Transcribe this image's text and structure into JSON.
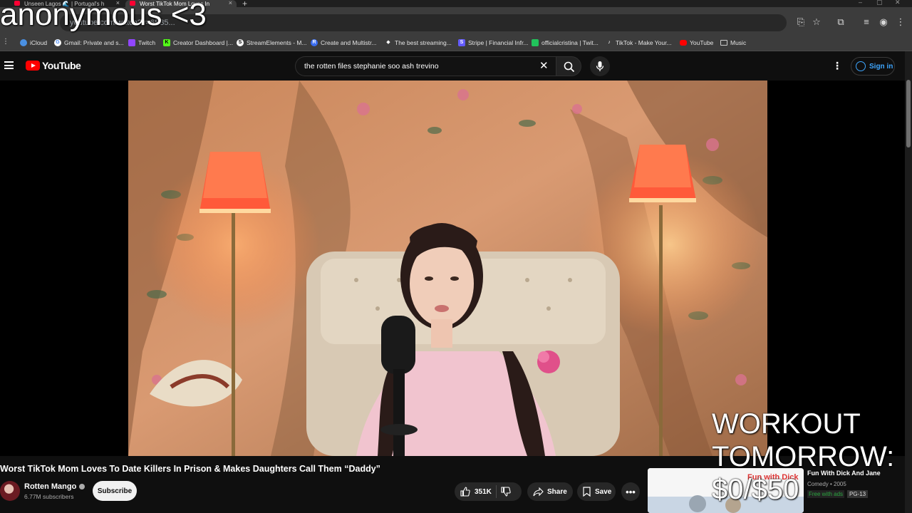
{
  "browser": {
    "tabs": [
      {
        "label": "Unseen Lagos 🌊 | Portugal's h"
      },
      {
        "label": "Worst TikTok Mom Loves In"
      }
    ],
    "url": "youtube.com/watch?v=6S35...",
    "bookmarks": [
      {
        "label": "iCloud",
        "icon": "cloud-icon",
        "color": "#4a90e2"
      },
      {
        "label": "Gmail: Private and s...",
        "icon": "google-icon",
        "color": "#ffffff"
      },
      {
        "label": "Twitch",
        "icon": "twitch-icon",
        "color": "#9146ff"
      },
      {
        "label": "Creator Dashboard |...",
        "icon": "kick-icon",
        "color": "#53fc18"
      },
      {
        "label": "StreamElements - M...",
        "icon": "streamelements-icon",
        "color": "#ffffff"
      },
      {
        "label": "Create and Multistr...",
        "icon": "restream-icon",
        "color": "#3a6df0"
      },
      {
        "label": "The best streaming...",
        "icon": "diamond-icon",
        "color": "#ffffff"
      },
      {
        "label": "Stripe | Financial Infr...",
        "icon": "stripe-icon",
        "color": "#635bff"
      },
      {
        "label": "officialcristina | Twit...",
        "icon": "twitch-green-icon",
        "color": "#21c35b"
      },
      {
        "label": "TikTok - Make Your...",
        "icon": "tiktok-icon",
        "color": "#ffffff"
      },
      {
        "label": "YouTube",
        "icon": "youtube-icon",
        "color": "#ff0000"
      },
      {
        "label": "Music",
        "icon": "folder-icon",
        "color": "#cccccc"
      }
    ]
  },
  "youtube": {
    "logo_text": "YouTube",
    "search_value": "the rotten files stephanie soo ash trevino",
    "sign_in": "Sign in"
  },
  "video": {
    "title": "Worst TikTok Mom Loves To Date Killers In Prison & Makes Daughters Call Them “Daddy”",
    "channel": "Rotten Mango",
    "subscribers": "6.77M subscribers",
    "subscribe_label": "Subscribe",
    "likes": "351K",
    "share_label": "Share",
    "save_label": "Save"
  },
  "recommendation": {
    "title": "Fun With Dick And Jane",
    "meta": "Comedy • 2005",
    "free_label": "Free with ads",
    "rating": "PG-13",
    "thumb_text": "Fun with Dick"
  },
  "overlays": {
    "name": "anonymous <3",
    "workout_line1": "WORKOUT",
    "workout_line2": "TOMORROW:",
    "workout_line3": "$0/$50"
  },
  "colors": {
    "yt_red": "#ff0000",
    "link_blue": "#3ea6ff",
    "background": "#0f0f0f"
  }
}
